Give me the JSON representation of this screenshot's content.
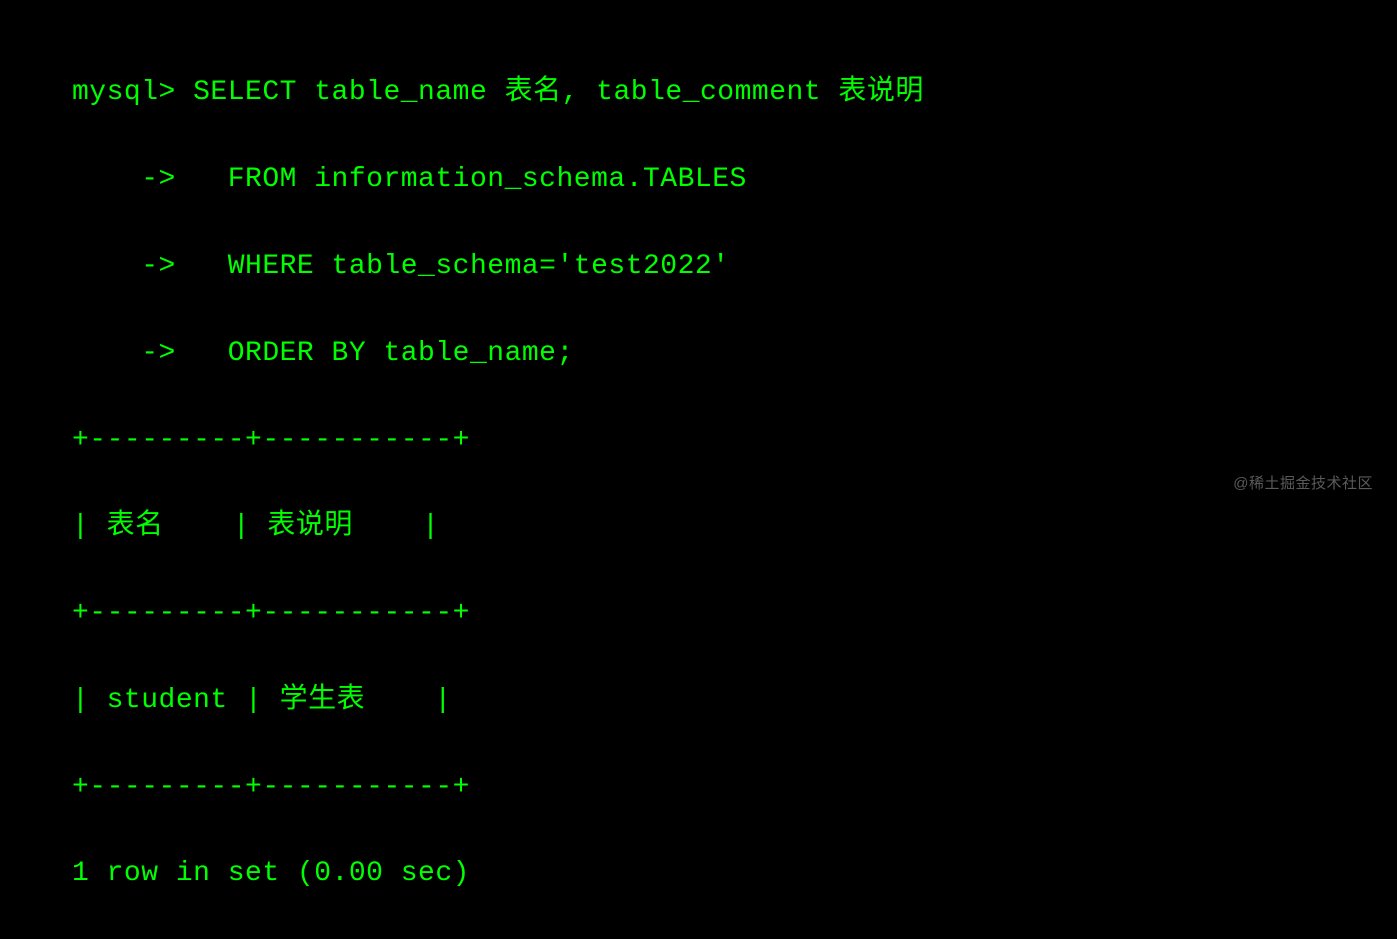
{
  "terminal": {
    "lines": [
      "mysql> SELECT table_name 表名, table_comment 表说明",
      "    ->   FROM information_schema.TABLES",
      "    ->   WHERE table_schema='test2022'",
      "    ->   ORDER BY table_name;",
      "+---------+-----------+",
      "| 表名    | 表说明    |",
      "+---------+-----------+",
      "| student | 学生表    |",
      "+---------+-----------+",
      "1 row in set (0.00 sec)"
    ]
  },
  "watermark": "@稀土掘金技术社区"
}
